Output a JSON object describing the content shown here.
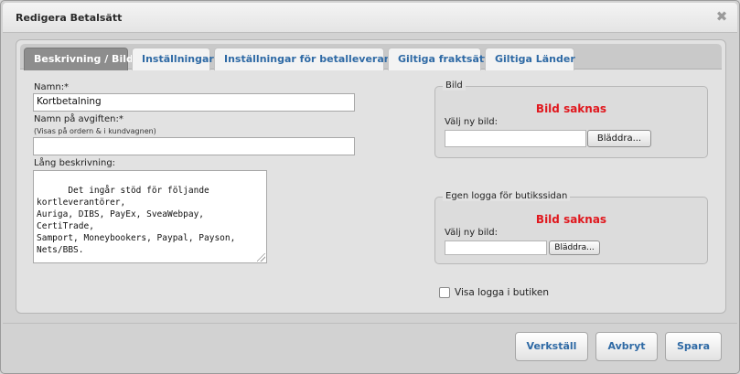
{
  "dialog": {
    "title": "Redigera Betalsätt",
    "close_glyph": "✖"
  },
  "tabs": [
    {
      "label": "Beskrivning / Bild",
      "active": true
    },
    {
      "label": "Inställningar",
      "active": false
    },
    {
      "label": "Inställningar för betalleverantör",
      "active": false
    },
    {
      "label": "Giltiga fraktsätt",
      "active": false
    },
    {
      "label": "Giltiga Länder",
      "active": false
    }
  ],
  "form": {
    "name_label": "Namn:*",
    "name_value": "Kortbetalning",
    "fee_label": "Namn på avgiften:*",
    "fee_hint": "(Visas på ordern & i kundvagnen)",
    "fee_value": "",
    "long_desc_label": "Lång beskrivning:",
    "long_desc_value": "Det ingår stöd för följande kortleverantörer,\nAuriga, DIBS, PayEx, SveaWebpay, CertiTrade,\nSamport, Moneybookers, Paypal, Payson,\nNets/BBS."
  },
  "image_box": {
    "legend": "Bild",
    "missing_text": "Bild saknas",
    "choose_label": "Välj ny bild:",
    "browse_label": "Bläddra..."
  },
  "logo_box": {
    "legend": "Egen logga för butikssidan",
    "missing_text": "Bild saknas",
    "choose_label": "Välj ny bild:",
    "browse_label": "Bläddra..."
  },
  "show_logo": {
    "label": "Visa logga i butiken",
    "checked": false
  },
  "footer": {
    "apply_label": "Verkställ",
    "cancel_label": "Avbryt",
    "save_label": "Spara"
  },
  "colors": {
    "accent": "#2f6aa5",
    "missing": "#e0181e",
    "active_tab": "#8d8d8d"
  }
}
